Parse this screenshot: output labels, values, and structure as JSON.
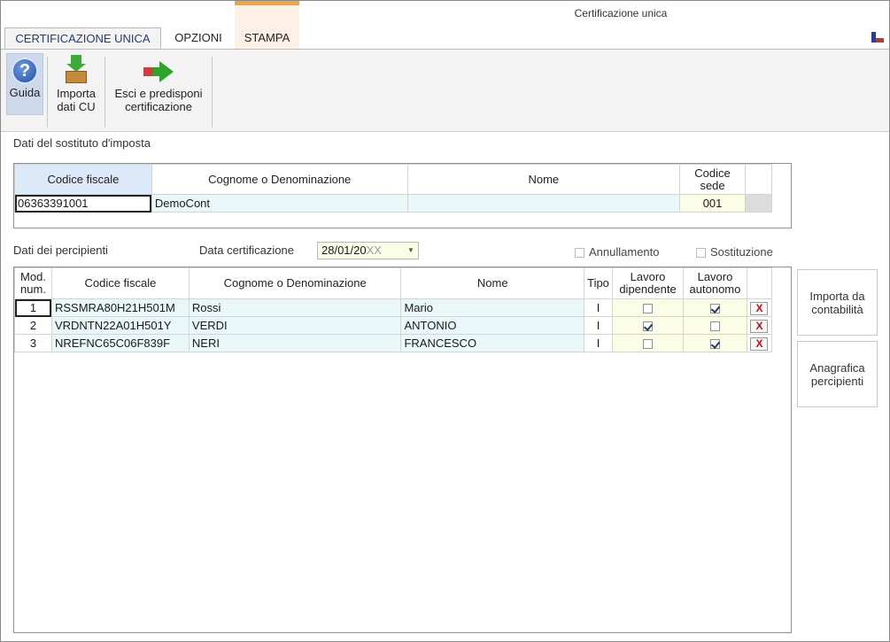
{
  "window": {
    "title": "Certificazione unica"
  },
  "tabs": [
    {
      "label": "CERTIFICAZIONE UNICA",
      "active": true
    },
    {
      "label": "OPZIONI",
      "active": false
    },
    {
      "label": "STAMPA",
      "active": false
    }
  ],
  "ribbon": {
    "guida": {
      "label": "Guida",
      "icon": "help-icon"
    },
    "importa": {
      "line1": "Importa",
      "line2": "dati CU",
      "icon": "import-icon"
    },
    "esci": {
      "line1": "Esci e predisponi",
      "line2": "certificazione",
      "icon": "exit-arrow-icon"
    }
  },
  "sostituto": {
    "section_label": "Dati del sostituto d'imposta",
    "headers": {
      "codice_fiscale": "Codice fiscale",
      "cognome": "Cognome o Denominazione",
      "nome": "Nome",
      "codice_sede_1": "Codice",
      "codice_sede_2": "sede"
    },
    "row": {
      "codice_fiscale": "06363391001",
      "cognome": "DemoCont",
      "nome": "",
      "codice_sede": "001"
    }
  },
  "percipienti": {
    "section_label": "Dati dei percipienti",
    "data_label": "Data certificazione",
    "data_value": "28/01/20",
    "data_value_suffix": "XX",
    "annullamento": {
      "label": "Annullamento",
      "checked": false
    },
    "sostituzione": {
      "label": "Sostituzione",
      "checked": false
    },
    "headers": {
      "mod_1": "Mod.",
      "mod_2": "num.",
      "codice_fiscale": "Codice fiscale",
      "cognome": "Cognome o Denominazione",
      "nome": "Nome",
      "tipo": "Tipo",
      "dip_1": "Lavoro",
      "dip_2": "dipendente",
      "aut_1": "Lavoro",
      "aut_2": "autonomo"
    },
    "rows": [
      {
        "num": "1",
        "codice_fiscale": "RSSMRA80H21H501M",
        "cognome": "Rossi",
        "nome": "Mario",
        "tipo": "I",
        "dipendente": false,
        "autonomo": true,
        "delete": "X"
      },
      {
        "num": "2",
        "codice_fiscale": "VRDNTN22A01H501Y",
        "cognome": "VERDI",
        "nome": "ANTONIO",
        "tipo": "I",
        "dipendente": true,
        "autonomo": false,
        "delete": "X"
      },
      {
        "num": "3",
        "codice_fiscale": "NREFNC65C06F839F",
        "cognome": "NERI",
        "nome": "FRANCESCO",
        "tipo": "I",
        "dipendente": false,
        "autonomo": true,
        "delete": "X"
      }
    ]
  },
  "side_buttons": {
    "importa_contabilita_1": "Importa da",
    "importa_contabilita_2": "contabilità",
    "anagrafica_1": "Anagrafica",
    "anagrafica_2": "percipienti"
  }
}
